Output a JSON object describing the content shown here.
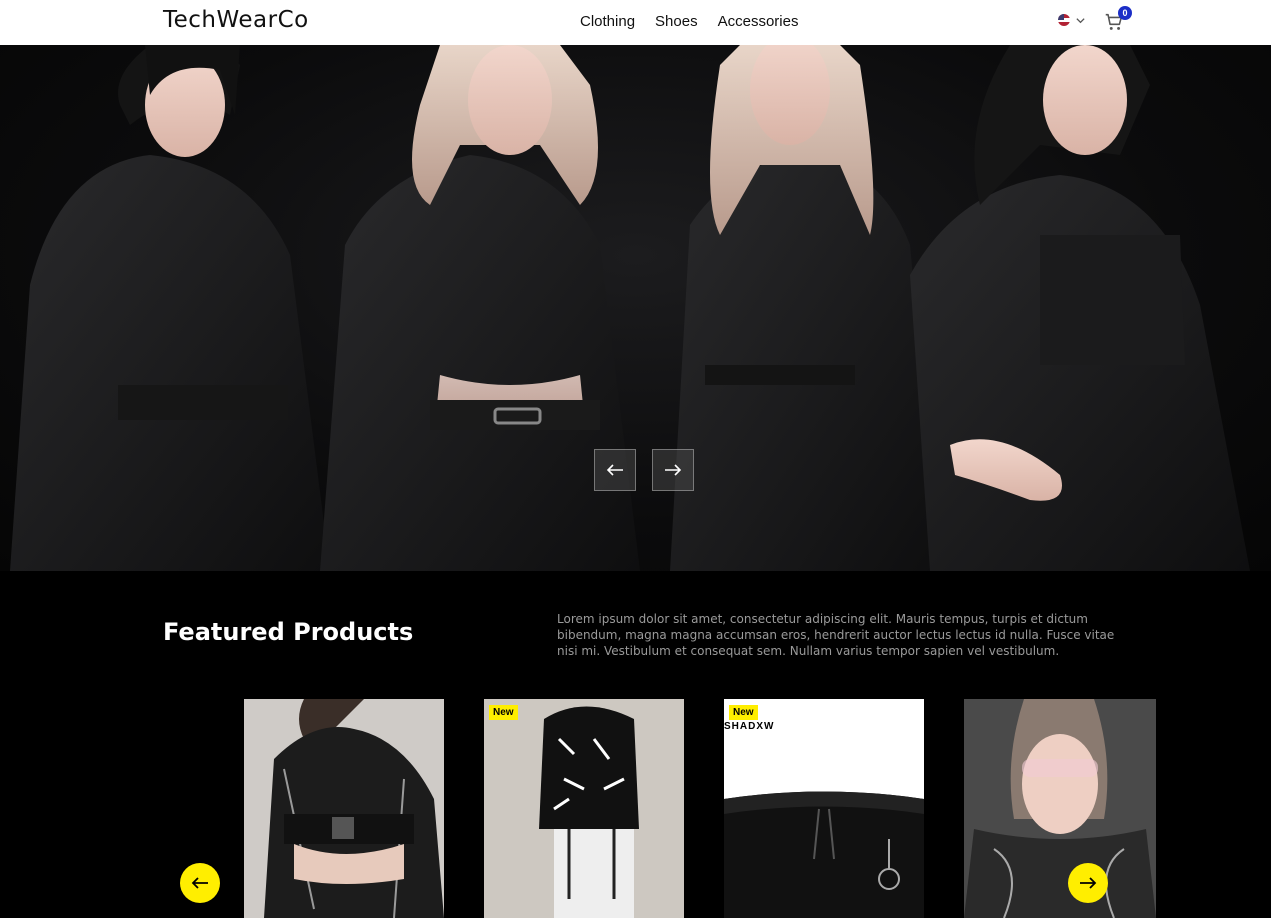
{
  "header": {
    "logo": "TechWearCo",
    "nav": [
      "Clothing",
      "Shoes",
      "Accessories"
    ],
    "cart_count": "0"
  },
  "featured": {
    "title": "Featured Products",
    "description": "Lorem ipsum dolor sit amet, consectetur adipiscing elit. Mauris tempus, turpis et dictum bibendum, magna magna accumsan eros, hendrerit auctor lectus lectus id nulla. Fusce vitae nisi mi. Vestibulum et consequat sem. Nullam varius tempor sapien vel vestibulum."
  },
  "products": [
    {
      "badge": ""
    },
    {
      "badge": "New"
    },
    {
      "badge": "New",
      "brand": "SHADXW"
    },
    {
      "badge": ""
    }
  ],
  "colors": {
    "accent": "#ffee00",
    "cart_badge": "#1b2ec7"
  }
}
